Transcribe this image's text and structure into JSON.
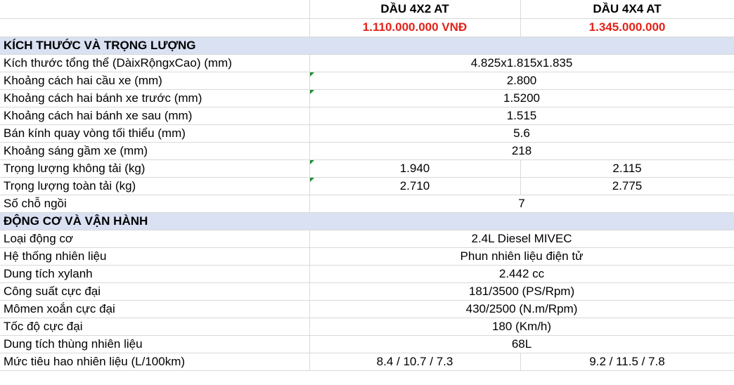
{
  "header": {
    "col1": "DẦU 4X2 AT",
    "col2": "DẦU 4X4 AT",
    "price1": "1.110.000.000 VNĐ",
    "price2": "1.345.000.000"
  },
  "colors": {
    "price": "#e2231a",
    "section_bg": "#d9e1f2",
    "grid": "#d9d9d9",
    "comment_flag": "#1e8f2f"
  },
  "sections": [
    {
      "title": "KÍCH THƯỚC VÀ TRỌNG LƯỢNG",
      "rows": [
        {
          "label": "Kích thước tổng thể (DàixRộngxCao) (mm)",
          "value": "4.825x1.815x1.835"
        },
        {
          "label": "Khoảng cách hai cầu xe (mm)",
          "value": "2.800"
        },
        {
          "label": "Khoảng cách hai bánh xe trước (mm)",
          "value": "1.5200"
        },
        {
          "label": "Khoảng cách hai bánh xe sau (mm)",
          "value": "1.515"
        },
        {
          "label": "Bán kính quay vòng tối thiểu (mm)",
          "value": "5.6"
        },
        {
          "label": "Khoảng sáng gầm xe (mm)",
          "value": "218"
        },
        {
          "label": "Trọng lượng không tải (kg)",
          "v1": "1.940",
          "v2": "2.115"
        },
        {
          "label": "Trọng lượng toàn tải (kg)",
          "v1": "2.710",
          "v2": "2.775"
        },
        {
          "label": "Số chỗ ngồi",
          "value": "7"
        }
      ]
    },
    {
      "title": "ĐỘNG CƠ VÀ VẬN HÀNH",
      "rows": [
        {
          "label": "Loại động cơ",
          "value": "2.4L Diesel MIVEC"
        },
        {
          "label": "Hệ thống nhiên liệu",
          "value": "Phun nhiên liệu điện tử"
        },
        {
          "label": "Dung tích xylanh",
          "value": "2.442 cc"
        },
        {
          "label": "Công suất cực đại",
          "value": "181/3500 (PS/Rpm)"
        },
        {
          "label": "Mômen xoắn cực đại",
          "value": "430/2500 (N.m/Rpm)"
        },
        {
          "label": "Tốc độ cực đại",
          "value": "180 (Km/h)"
        },
        {
          "label": "Dung tích thùng nhiên liệu",
          "value": "68L"
        },
        {
          "label": "Mức tiêu hao nhiên liệu (L/100km)",
          "v1": "8.4 / 10.7 / 7.3",
          "v2": "9.2 / 11.5 / 7.8"
        }
      ]
    }
  ]
}
